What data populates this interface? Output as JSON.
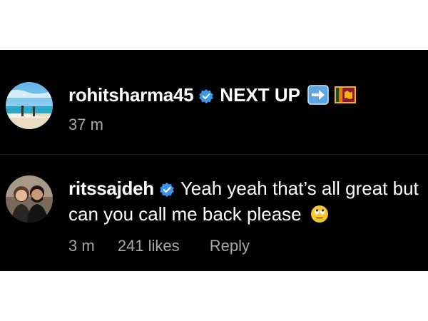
{
  "comments": [
    {
      "username": "rohitsharma45",
      "text": "NEXT UP",
      "time": "37 m",
      "icons": [
        "verified-badge",
        "right-arrow-emoji",
        "sri-lanka-flag-emoji"
      ]
    },
    {
      "username": "ritssajdeh",
      "text_line1": "Yeah yeah that’s all great but",
      "text_line2": "can you call me back please",
      "time": "3 m",
      "likes": "241 likes",
      "reply": "Reply",
      "icons": [
        "verified-badge",
        "eye-roll-emoji"
      ]
    }
  ],
  "colors": {
    "background": "#000000",
    "text": "#ffffff",
    "meta_text": "#a8a8a8",
    "verified_badge": "#3897f0"
  }
}
